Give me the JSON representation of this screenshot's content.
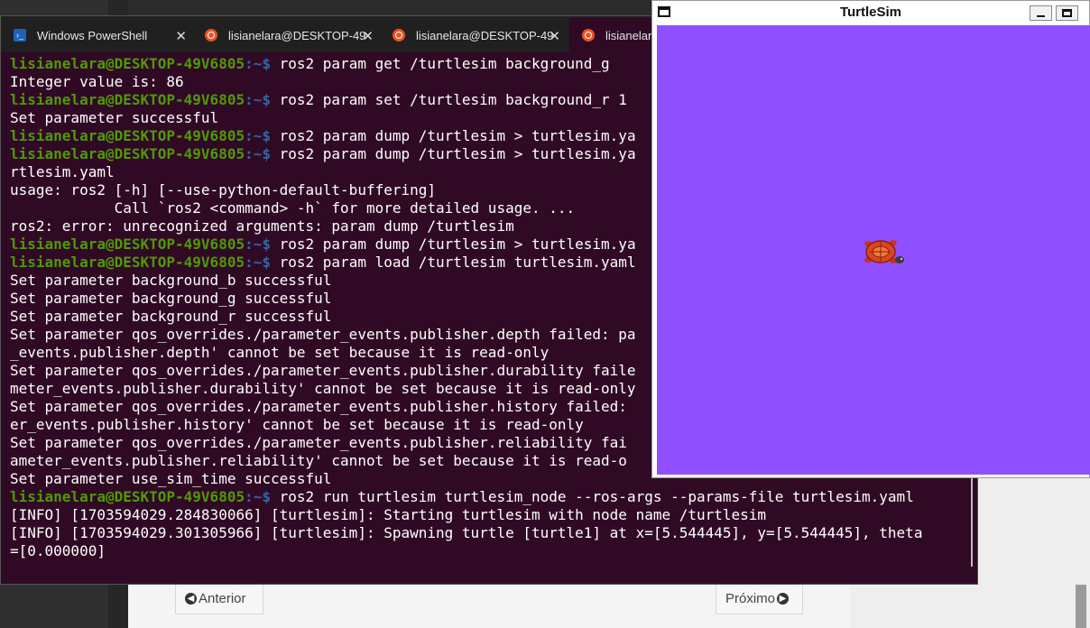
{
  "terminal": {
    "tabs": [
      {
        "label": "Windows PowerShell",
        "icon": "powershell-icon",
        "close": "✕"
      },
      {
        "label": "lisianelara@DESKTOP-49",
        "icon": "ubuntu-icon",
        "close": "✕"
      },
      {
        "label": "lisianelara@DESKTOP-49",
        "icon": "ubuntu-icon",
        "close": "✕"
      },
      {
        "label": "lisianelara",
        "icon": "ubuntu-icon",
        "close": ""
      }
    ],
    "prompt_user": "lisianelara@DESKTOP-49V6805",
    "prompt_path": ":~$ ",
    "lines": [
      {
        "type": "cmd",
        "text": "ros2 param get /turtlesim background_g"
      },
      {
        "type": "out",
        "text": "Integer value is: 86"
      },
      {
        "type": "cmd",
        "text": "ros2 param set /turtlesim background_r 1"
      },
      {
        "type": "out",
        "text": "Set parameter successful"
      },
      {
        "type": "cmd",
        "text": "ros2 param dump /turtlesim > turtlesim.ya"
      },
      {
        "type": "cmd",
        "text": "ros2 param dump /turtlesim > turtlesim.ya"
      },
      {
        "type": "out",
        "text": "rtlesim.yaml"
      },
      {
        "type": "out",
        "text": "usage: ros2 [-h] [--use-python-default-buffering]"
      },
      {
        "type": "out",
        "text": "            Call `ros2 <command> -h` for more detailed usage. ..."
      },
      {
        "type": "out",
        "text": "ros2: error: unrecognized arguments: param dump /turtlesim"
      },
      {
        "type": "cmd",
        "text": "ros2 param dump /turtlesim > turtlesim.ya"
      },
      {
        "type": "cmd",
        "text": "ros2 param load /turtlesim turtlesim.yaml"
      },
      {
        "type": "out",
        "text": "Set parameter background_b successful"
      },
      {
        "type": "out",
        "text": "Set parameter background_g successful"
      },
      {
        "type": "out",
        "text": "Set parameter background_r successful"
      },
      {
        "type": "out",
        "text": "Set parameter qos_overrides./parameter_events.publisher.depth failed: pa"
      },
      {
        "type": "out",
        "text": "_events.publisher.depth' cannot be set because it is read-only"
      },
      {
        "type": "out",
        "text": "Set parameter qos_overrides./parameter_events.publisher.durability faile"
      },
      {
        "type": "out",
        "text": "meter_events.publisher.durability' cannot be set because it is read-only"
      },
      {
        "type": "out",
        "text": "Set parameter qos_overrides./parameter_events.publisher.history failed:"
      },
      {
        "type": "out",
        "text": "er_events.publisher.history' cannot be set because it is read-only"
      },
      {
        "type": "out",
        "text": "Set parameter qos_overrides./parameter_events.publisher.reliability fai"
      },
      {
        "type": "out",
        "text": "ameter_events.publisher.reliability' cannot be set because it is read-o"
      },
      {
        "type": "out",
        "text": "Set parameter use_sim_time successful"
      },
      {
        "type": "cmd",
        "text": "ros2 run turtlesim turtlesim_node --ros-args --params-file turtlesim.yaml"
      },
      {
        "type": "out",
        "text": "[INFO] [1703594029.284830066] [turtlesim]: Starting turtlesim with node name /turtlesim"
      },
      {
        "type": "out",
        "text": "[INFO] [1703594029.301305966] [turtlesim]: Spawning turtle [turtle1] at x=[5.544445], y=[5.544445], theta"
      },
      {
        "type": "out",
        "text": "=[0.000000]"
      }
    ],
    "colors": {
      "background": "#300a24",
      "user": "#4e9a06",
      "path": "#3465a4"
    }
  },
  "turtlesim": {
    "title": "TurtleSim",
    "background_color": "#9150ff",
    "turtle_icon": "turtle-icon"
  },
  "page": {
    "prev_label": "Anterior",
    "next_label": "Próximo"
  }
}
